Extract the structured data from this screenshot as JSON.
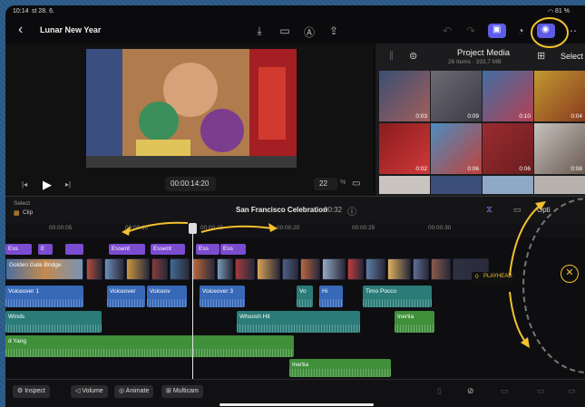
{
  "status": {
    "time": "10:14",
    "date": "st 28. 6.",
    "battery": "81 %"
  },
  "header": {
    "back_label": "‹",
    "title": "Lunar New Year"
  },
  "viewer": {
    "timecode": "00:00:14:20",
    "zoom": "22",
    "zoom_unit": "%"
  },
  "media": {
    "title": "Project Media",
    "subtitle": "26 Items · 333,7 MB",
    "select_label": "Select",
    "thumbs": [
      {
        "dur": "0:03",
        "c1": "#3a4f74",
        "c2": "#a35e5a"
      },
      {
        "dur": "0:09",
        "c1": "#6c6a73",
        "c2": "#3c3b45"
      },
      {
        "dur": "0:10",
        "c1": "#3f6fa3",
        "c2": "#b63f53"
      },
      {
        "dur": "0:04",
        "c1": "#c19931",
        "c2": "#8a3b1e"
      },
      {
        "dur": "0:02",
        "c1": "#8a1d1d",
        "c2": "#d0383b"
      },
      {
        "dur": "0:06",
        "c1": "#4b8ec0",
        "c2": "#c0403a"
      },
      {
        "dur": "0:06",
        "c1": "#9a2c30",
        "c2": "#6b1d1f"
      },
      {
        "dur": "0:08",
        "c1": "#c7c2bd",
        "c2": "#6a5b52"
      }
    ]
  },
  "timeline": {
    "select_label": "Select",
    "clip_label": "Clip",
    "project_name": "San Francisco Celebration",
    "duration": "00:32",
    "options_label": "Opti",
    "playhead_label": "PLAYHEAD",
    "playhead_value": "0",
    "ruler": [
      "00:00:05",
      "00:00:10",
      "00:00:15",
      "00:00:20",
      "00:00:25",
      "00:00:30"
    ],
    "titles": [
      "Ess",
      "E",
      "Essent",
      "Essent",
      "Ess",
      "Ess"
    ],
    "video_label": "Golden Gate Bridge",
    "voiceovers": [
      "Voiceover 1",
      "Voiceover",
      "Voiceov",
      "Voiceover 3",
      "Vo",
      "Hi",
      "Timo Pocco"
    ],
    "whoosh": "Whoosh Hit",
    "winds": "Winds",
    "inertia1": "Inertia",
    "yang": "d Yang",
    "inertia2": "Inertia"
  },
  "bottom": {
    "inspect": "Inspect",
    "volume": "Volume",
    "animate": "Animate",
    "multicam": "Multicam"
  },
  "colors": {
    "accent": "#5e5ce6",
    "annotation": "#f2c12e",
    "title_clip": "#7b4bd0",
    "voiceover": "#3869b8"
  }
}
